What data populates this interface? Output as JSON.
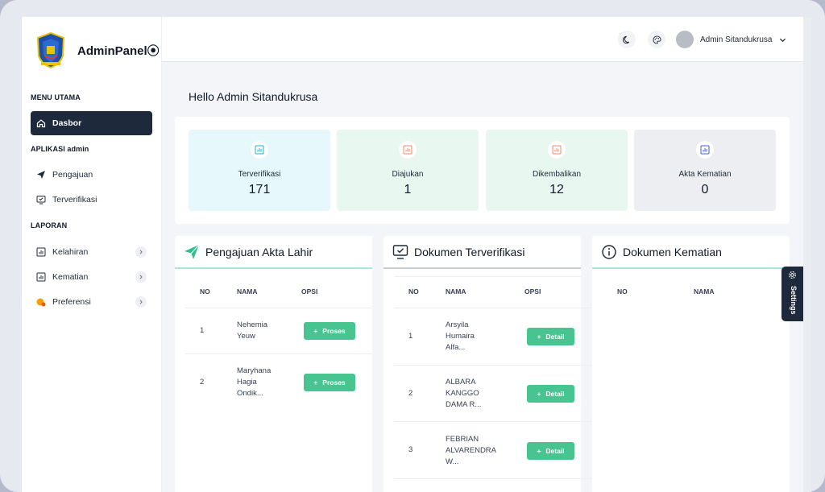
{
  "sidebar": {
    "brand": "AdminPanel⦿",
    "sections": {
      "menu": "MENU UTAMA",
      "apps": "APLIKASI admin",
      "reports": "LAPORAN"
    },
    "items": {
      "dasbor": "Dasbor",
      "pengajuan": "Pengajuan",
      "terverifikasi": "Terverifikasi",
      "kelahiran": "Kelahiran",
      "kematian": "Kematian",
      "preferensi": "Preferensi"
    }
  },
  "topbar": {
    "user_name": "Admin Sitandukrusa"
  },
  "greeting": "Hello Admin Sitandukrusa",
  "stats": [
    {
      "label": "Terverifikasi",
      "value": "171"
    },
    {
      "label": "Diajukan",
      "value": "1"
    },
    {
      "label": "Dikembalikan",
      "value": "12"
    },
    {
      "label": "Akta Kematian",
      "value": "0"
    }
  ],
  "cards": {
    "pengajuan": {
      "title": "Pengajuan Akta Lahir",
      "headers": {
        "no": "NO",
        "nama": "NAMA",
        "opsi": "OPSI"
      },
      "button_label": "Proses",
      "rows": [
        {
          "no": "1",
          "name_lines": [
            "Nehemia",
            "Yeuw"
          ]
        },
        {
          "no": "2",
          "name_lines": [
            "Maryhana",
            "Hagia",
            "Ondik..."
          ]
        }
      ]
    },
    "terverifikasi": {
      "title": "Dokumen Terverifikasi",
      "headers": {
        "no": "NO",
        "nama": "NAMA",
        "opsi": "OPSI"
      },
      "button_label": "Detail",
      "rows": [
        {
          "no": "1",
          "name_lines": [
            "Arsyila",
            "Humaira",
            "Alfa..."
          ]
        },
        {
          "no": "2",
          "name_lines": [
            "ALBARA",
            "KANGGO",
            "DAMA R..."
          ]
        },
        {
          "no": "3",
          "name_lines": [
            "FEBRIAN",
            "ALVARENDRA",
            "W..."
          ]
        }
      ]
    },
    "kematian": {
      "title": "Dokumen Kematian",
      "headers": {
        "no": "NO",
        "nama": "NAMA"
      }
    }
  },
  "settings_label": "Settings",
  "colors": {
    "sidebar_active": "#1e293b",
    "accent_green": "#47c490",
    "stat_bg": [
      "#e6f8fb",
      "#e9f7f1",
      "#e9f7f1",
      "#eceef2"
    ],
    "stat_icon": [
      "#14b8c8",
      "#f08a6c",
      "#f08a6c",
      "#3b5bdb"
    ]
  }
}
